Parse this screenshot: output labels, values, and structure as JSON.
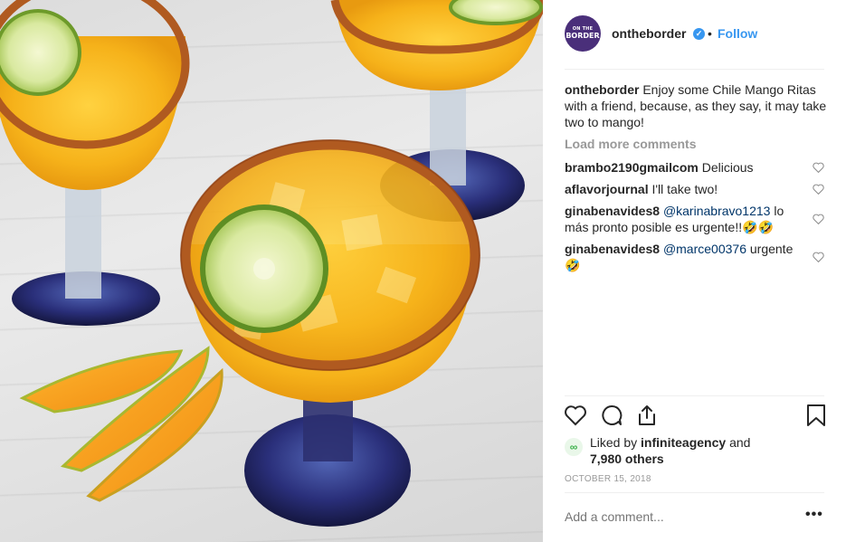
{
  "post": {
    "username": "ontheborder",
    "avatar_text_top": "ON THE",
    "avatar_text_bottom": "BORDER",
    "follow_label": "Follow",
    "separator": "•",
    "verified_glyph": "✓",
    "caption": {
      "username": "ontheborder",
      "text": "Enjoy some Chile Mango Ritas with a friend, because, as they say, it may take two to mango!"
    },
    "load_more_label": "Load more comments",
    "comments": [
      {
        "username": "brambo2190gmailcom",
        "text": "Delicious"
      },
      {
        "username": "aflavorjournal",
        "text": "I'll take two!"
      },
      {
        "username": "ginabenavides8",
        "mention": "@karinabravo1213",
        "text": "lo más pronto posible es urgente!!🤣🤣"
      },
      {
        "username": "ginabenavides8",
        "mention": "@marce00376",
        "text": "urgente 🤣"
      }
    ],
    "likes": {
      "prefix": "Liked by",
      "by_user": "infiniteagency",
      "middle": "and",
      "others": "7,980 others"
    },
    "date": "OCTOBER 15, 2018",
    "add_comment_placeholder": "Add a comment...",
    "more_label": "•••"
  },
  "icons": {
    "like": "heart-icon",
    "comment": "comment-bubble-icon",
    "share": "share-icon",
    "save": "bookmark-icon",
    "comment_like": "heart-outline-icon",
    "liked_by_avatar": "infinity-icon"
  },
  "colors": {
    "accent": "#3897f0",
    "brand_purple": "#4a2f7a",
    "mention": "#003569",
    "muted": "#999999"
  }
}
